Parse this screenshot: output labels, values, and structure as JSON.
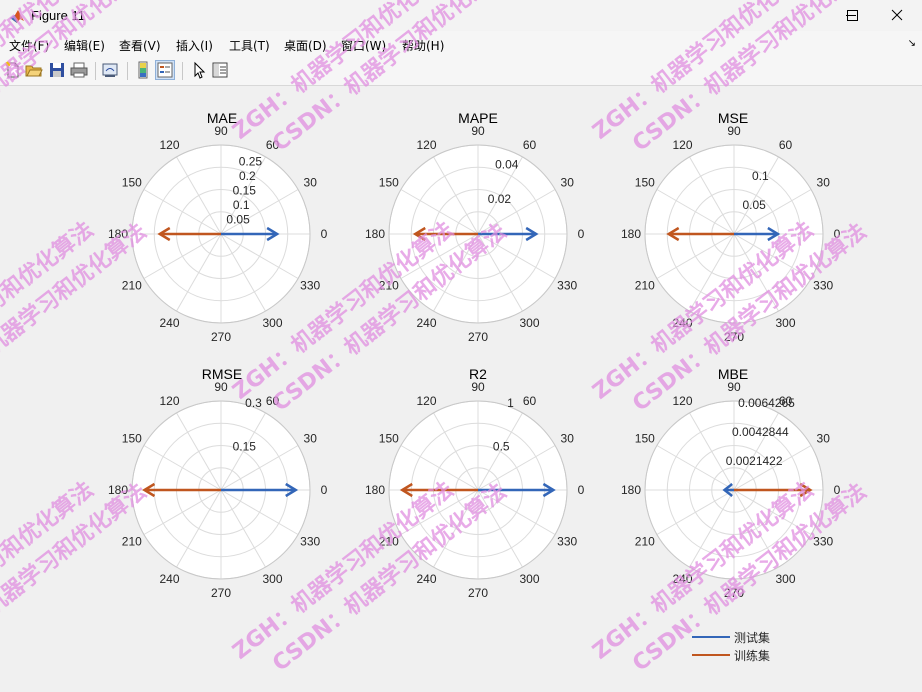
{
  "window": {
    "title": "Figure 11"
  },
  "menu": [
    "文件(F)",
    "编辑(E)",
    "查看(V)",
    "插入(I)",
    "工具(T)",
    "桌面(D)",
    "窗口(W)",
    "帮助(H)"
  ],
  "toolbar_icons": [
    "new-figure-icon",
    "open-file-icon",
    "save-icon",
    "print-icon",
    "link-plot-icon",
    "insert-colorbar-icon",
    "insert-legend-icon",
    "edit-plot-icon",
    "property-inspector-icon"
  ],
  "colors": {
    "test": "#3366b8",
    "train": "#c0561f",
    "watermark": "#e08fe0"
  },
  "theta_labels": [
    "0",
    "30",
    "60",
    "90",
    "120",
    "150",
    "180",
    "210",
    "240",
    "270",
    "300",
    "330"
  ],
  "legend": [
    {
      "label": "测试集",
      "color": "#3366b8"
    },
    {
      "label": "训练集",
      "color": "#c0561f"
    }
  ],
  "watermark": {
    "line1": "ZGH：机器学习和优化算法",
    "line2": "CSDN：机器学习和优化算法"
  },
  "chart_data": [
    {
      "type": "polar",
      "title": "MAE",
      "rlim": [
        0,
        0.3
      ],
      "rticks": [
        "0.05",
        "0.1",
        "0.15",
        "0.2",
        "0.25"
      ],
      "series": [
        {
          "name": "测试集",
          "theta": 0,
          "r": 0.22
        },
        {
          "name": "训练集",
          "theta": 180,
          "r": 0.24
        }
      ]
    },
    {
      "type": "polar",
      "title": "MAPE",
      "rlim": [
        0,
        0.05
      ],
      "rticks": [
        "0.02",
        "0.04"
      ],
      "series": [
        {
          "name": "测试集",
          "theta": 0,
          "r": 0.038
        },
        {
          "name": "训练集",
          "theta": 180,
          "r": 0.041
        }
      ]
    },
    {
      "type": "polar",
      "title": "MSE",
      "rlim": [
        0,
        0.15
      ],
      "rticks": [
        "0.05",
        "0.1"
      ],
      "series": [
        {
          "name": "测试集",
          "theta": 0,
          "r": 0.086
        },
        {
          "name": "训练集",
          "theta": 180,
          "r": 0.128
        }
      ]
    },
    {
      "type": "polar",
      "title": "RMSE",
      "rlim": [
        0,
        0.3
      ],
      "rticks": [
        "0.15",
        "0.3"
      ],
      "series": [
        {
          "name": "测试集",
          "theta": 0,
          "r": 0.293
        },
        {
          "name": "训练集",
          "theta": 180,
          "r": 0.358
        }
      ]
    },
    {
      "type": "polar",
      "title": "R2",
      "rlim": [
        0,
        1
      ],
      "rticks": [
        "0.5",
        "1"
      ],
      "series": [
        {
          "name": "测试集",
          "theta": 0,
          "r": 0.985
        },
        {
          "name": "训练集",
          "theta": 180,
          "r": 0.99
        }
      ]
    },
    {
      "type": "polar",
      "title": "MBE",
      "rlim": [
        0,
        0.0064265
      ],
      "rticks": [
        "0.0021422",
        "0.0042844",
        "0.0064265"
      ],
      "series": [
        {
          "name": "测试集",
          "theta": 180,
          "r": 0.0008
        },
        {
          "name": "训练集",
          "theta": 0,
          "r": 0.0064
        }
      ]
    }
  ]
}
